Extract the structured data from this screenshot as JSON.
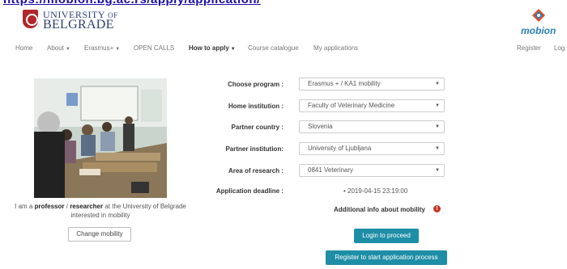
{
  "browser": {
    "url": "https://mobion.bg.ac.rs/apply/application/"
  },
  "header": {
    "university_line1_main": "UNIVERSITY",
    "university_line1_small": "OF",
    "university_line2": "BELGRADE",
    "brand": "mobion"
  },
  "nav": {
    "home": "Home",
    "about": "About",
    "erasmus": "Erasmus+",
    "open_calls": "OPEN CALLS",
    "how_to_apply": "How to apply",
    "course_catalogue": "Course catalogue",
    "my_applications": "My applications",
    "register": "Register",
    "login": "Log"
  },
  "profile": {
    "caption_prefix": "I am a",
    "caption_role1": "professor",
    "caption_sep": " / ",
    "caption_role2": "researcher",
    "caption_suffix": "at the University of Belgrade interested in mobility",
    "change_button": "Change mobility"
  },
  "form": {
    "program_label": "Choose program :",
    "program_value": "Erasmus + / KA1 mobility",
    "home_label": "Home institution :",
    "home_value": "Faculty of Veterinary Medicine",
    "country_label": "Partner country :",
    "country_value": "Slovenia",
    "partner_label": "Partner institution:",
    "partner_value": "University of Ljubljana",
    "research_label": "Area of research :",
    "research_value": "0841 Veterinary",
    "deadline_label": "Application deadline :",
    "deadline_value": "2019-04-15 23:19:00",
    "info_title": "Additional info about mobility",
    "login_button": "Login to proceed",
    "register_button": "Register to start application process"
  }
}
